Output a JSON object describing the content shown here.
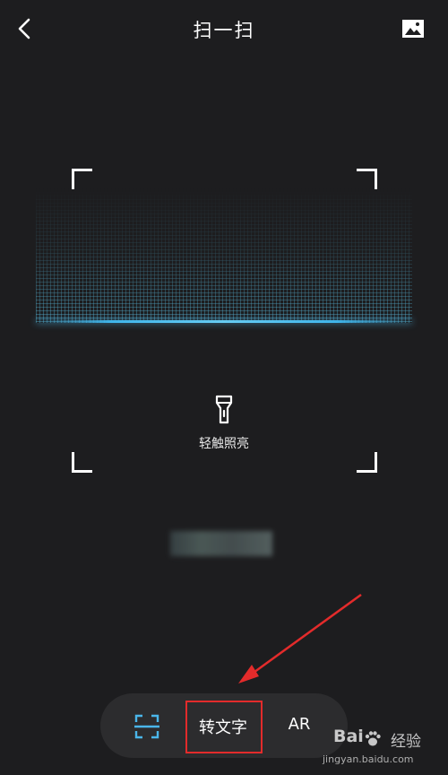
{
  "header": {
    "title": "扫一扫",
    "back_icon": "chevron-left-icon",
    "album_icon": "image-icon"
  },
  "scanner": {
    "accent": "#3fb4ea",
    "flashlight_icon": "flashlight-icon",
    "flashlight_label": "轻触照亮"
  },
  "modes": {
    "items": [
      {
        "icon": "scan-frame-icon",
        "label": "",
        "color": "#4ab6ea"
      },
      {
        "label": "转文字",
        "highlighted": true
      },
      {
        "label": "AR"
      }
    ],
    "highlight_color": "#e32b2b"
  },
  "watermark": {
    "brand": "Bai",
    "experience": "经验",
    "url": "jingyan.baidu.com"
  }
}
